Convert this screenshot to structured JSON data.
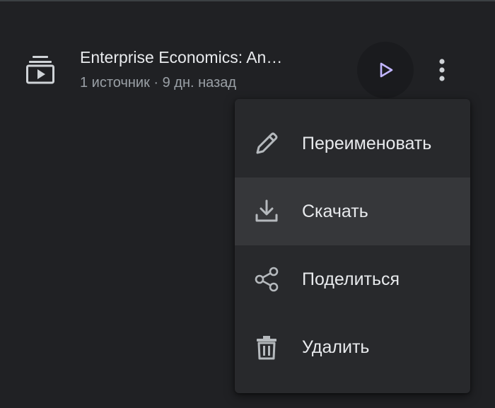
{
  "notebook": {
    "title": "Enterprise Economics: An…",
    "meta": "1 источник · 9 дн. назад",
    "icon": "video-collection-icon",
    "play_icon": "play-icon",
    "more_icon": "more-vert-icon",
    "accent_color": "#c2b6ff"
  },
  "menu": {
    "items": [
      {
        "label": "Переименовать",
        "icon": "pencil-icon"
      },
      {
        "label": "Скачать",
        "icon": "download-icon",
        "highlighted": true
      },
      {
        "label": "Поделиться",
        "icon": "share-icon"
      },
      {
        "label": "Удалить",
        "icon": "trash-icon"
      }
    ]
  }
}
